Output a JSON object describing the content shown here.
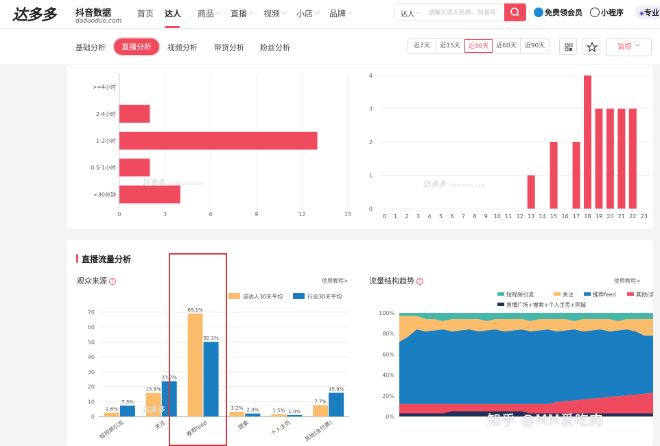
{
  "header": {
    "logo_text": "达多多",
    "logo_sub": "抖音数据",
    "logo_domain": "daduoduo.com",
    "nav": [
      {
        "label": "首页",
        "has_caret": false
      },
      {
        "label": "达人",
        "has_caret": false
      },
      {
        "label": "商品",
        "has_caret": true
      },
      {
        "label": "直播",
        "has_caret": true
      },
      {
        "label": "视频",
        "has_caret": true
      },
      {
        "label": "小店",
        "has_caret": true
      },
      {
        "label": "品牌",
        "has_caret": true
      }
    ],
    "search": {
      "type": "达人",
      "placeholder": "请输入达人名称、抖音号"
    },
    "free_member": "免费领会员",
    "mini_program": "小程序",
    "pro": "专业"
  },
  "subnav": {
    "tabs": [
      "基础分析",
      "直播分析",
      "视频分析",
      "带货分析",
      "粉丝分析"
    ],
    "active_tab": 1,
    "ranges": [
      "近7天",
      "近15天",
      "近30天",
      "近60天",
      "近90天"
    ],
    "active_range": 2,
    "monitor": "监控"
  },
  "colors": {
    "accent": "#f04a5e",
    "bar_red": "#f04a5e",
    "orange": "#fbbd6b",
    "blue": "#1b7ec0",
    "teal": "#45b7a9",
    "navy": "#1e2f5a"
  },
  "chart_data": [
    {
      "type": "bar",
      "orientation": "horizontal",
      "categories": [
        "<30分钟",
        "0.5-1小时",
        "1-2小时",
        "2-4小时",
        ">=4小时"
      ],
      "values": [
        4,
        2,
        13,
        2,
        0
      ],
      "xticks": [
        0,
        3,
        6,
        9,
        12,
        15
      ],
      "xlim": [
        0,
        15
      ]
    },
    {
      "type": "bar",
      "categories": [
        "0",
        "1",
        "2",
        "3",
        "4",
        "5",
        "6",
        "7",
        "8",
        "9",
        "10",
        "11",
        "12",
        "13",
        "14",
        "15",
        "16",
        "17",
        "18",
        "19",
        "20",
        "21",
        "22",
        "23"
      ],
      "values": [
        0,
        0,
        0,
        0,
        0,
        0,
        0,
        0,
        0,
        0,
        0,
        0,
        0,
        1,
        0,
        2,
        0,
        2,
        4,
        3,
        3,
        3,
        3,
        0
      ],
      "yticks": [
        0,
        1,
        2,
        3,
        4
      ],
      "ylim": [
        0,
        4
      ]
    },
    {
      "type": "bar",
      "categories": [
        "短视频引流",
        "关注",
        "推荐feed",
        "搜索",
        "个人主页",
        "其他(含付费)"
      ],
      "series": [
        {
          "name": "该达人30天平均",
          "values": [
            2.6,
            15.8,
            69.1,
            3.2,
            1.5,
            7.7
          ],
          "labels": [
            "2.6%",
            "15.8%",
            "69.1%",
            "3.2%",
            "1.5%",
            "7.7%"
          ]
        },
        {
          "name": "行业30天平均",
          "values": [
            7.3,
            23.7,
            50.1,
            2.0,
            1.0,
            15.9
          ],
          "labels": [
            "7.3%",
            "23.7%",
            "50.1%",
            "2.0%",
            "1.0%",
            "15.9%"
          ]
        }
      ],
      "yticks": [
        0,
        10,
        20,
        30,
        40,
        50,
        60,
        70
      ],
      "ylim": [
        0,
        70
      ],
      "legend": "top-right"
    },
    {
      "type": "area",
      "stacked_percent": true,
      "series_names": [
        "短视频引流",
        "关注",
        "推荐feed",
        "其他(含付费)",
        "直播广场+搜索+个人主页+同城"
      ],
      "yticks": [
        "0%",
        "20%",
        "40%",
        "60%",
        "80%",
        "100%"
      ],
      "ylim": [
        0,
        100
      ],
      "legend": "top"
    }
  ],
  "sections": {
    "traffic_title": "直播流量分析",
    "audience_source": "观众来源",
    "traffic_trend": "流量结构趋势",
    "tutorial": "使用教程>"
  },
  "watermark": {
    "chart": "达多多",
    "chart_domain": "daduoduo.com",
    "corner": "知乎 @MM爱吃肉"
  }
}
